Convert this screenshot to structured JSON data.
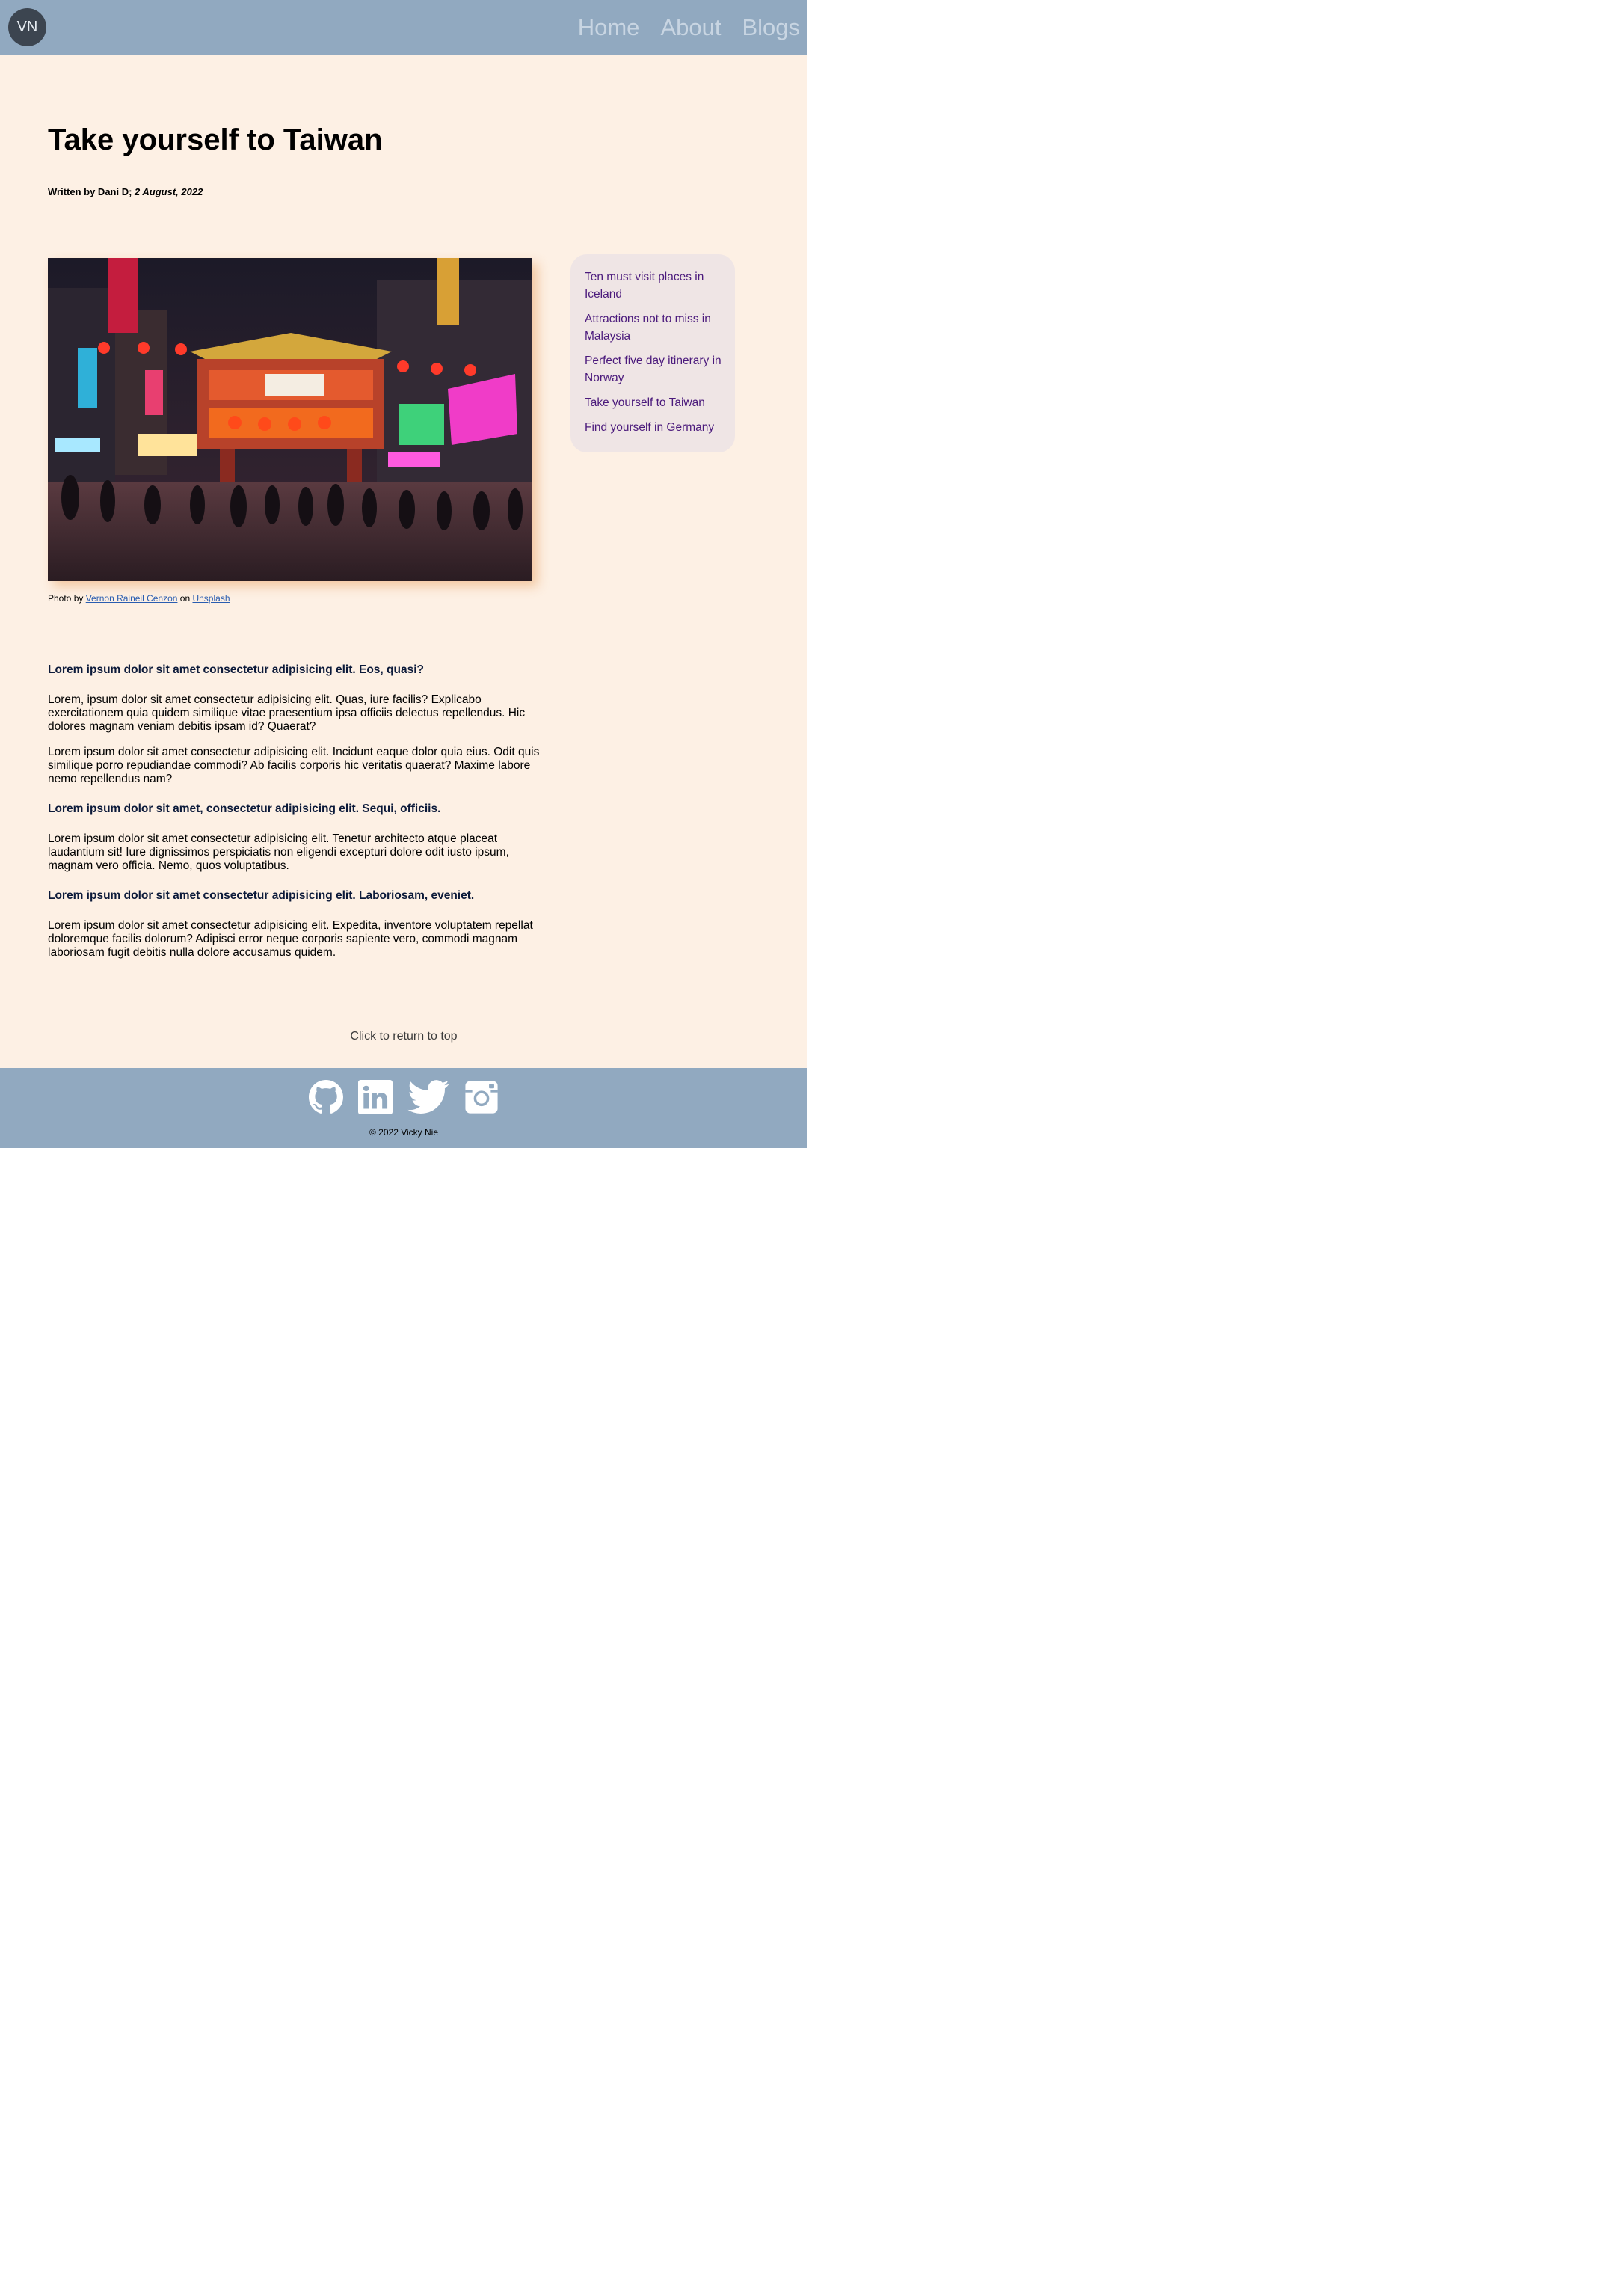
{
  "header": {
    "logo_text": "VN",
    "nav": [
      {
        "label": "Home"
      },
      {
        "label": "About"
      },
      {
        "label": "Blogs"
      }
    ],
    "background": "#91a9c0"
  },
  "post": {
    "title": "Take yourself to Taiwan",
    "byline_prefix": "Written by Dani D; ",
    "date": "2 August, 2022",
    "image_alt": "night-market-gate-photo",
    "caption": {
      "prefix": "Photo by ",
      "author": "Vernon Raineil Cenzon",
      "middle": " on ",
      "source": "Unsplash"
    },
    "sections": [
      {
        "heading": "Lorem ipsum dolor sit amet consectetur adipisicing elit. Eos, quasi?"
      },
      {
        "text": "Lorem, ipsum dolor sit amet consectetur adipisicing elit. Quas, iure facilis? Explicabo exercitationem quia quidem similique vitae praesentium ipsa officiis delectus repellendus. Hic dolores magnam veniam debitis ipsam id? Quaerat?"
      },
      {
        "text": "Lorem ipsum dolor sit amet consectetur adipisicing elit. Incidunt eaque dolor quia eius. Odit quis similique porro repudiandae commodi? Ab facilis corporis hic veritatis quaerat? Maxime labore nemo repellendus nam?"
      },
      {
        "heading": "Lorem ipsum dolor sit amet, consectetur adipisicing elit. Sequi, officiis."
      },
      {
        "text": "Lorem ipsum dolor sit amet consectetur adipisicing elit. Tenetur architecto atque placeat laudantium sit! Iure dignissimos perspiciatis non eligendi excepturi dolore odit iusto ipsum, magnam vero officia. Nemo, quos voluptatibus."
      },
      {
        "heading": "Lorem ipsum dolor sit amet consectetur adipisicing elit. Laboriosam, eveniet."
      },
      {
        "text": "Lorem ipsum dolor sit amet consectetur adipisicing elit. Expedita, inventore voluptatem repellat doloremque facilis dolorum? Adipisci error neque corporis sapiente vero, commodi magnam laboriosam fugit debitis nulla dolore accusamus quidem."
      }
    ]
  },
  "sidebar": {
    "links": [
      {
        "label": "Ten must visit places in Iceland"
      },
      {
        "label": "Attractions not to miss in Malaysia"
      },
      {
        "label": "Perfect five day itinerary in Norway"
      },
      {
        "label": "Take yourself to Taiwan"
      },
      {
        "label": "Find yourself in Germany"
      }
    ],
    "link_color": "#4b1a7c"
  },
  "return_top": "Click to return to top",
  "footer": {
    "socials": [
      {
        "icon": "github-icon"
      },
      {
        "icon": "linkedin-icon"
      },
      {
        "icon": "twitter-icon"
      },
      {
        "icon": "instagram-icon"
      }
    ],
    "copyright": "© 2022 Vicky Nie"
  },
  "colors": {
    "page_background": "#fdf0e4",
    "sidebar_background": "#efe5e5",
    "caption_link": "#2a5db0"
  }
}
